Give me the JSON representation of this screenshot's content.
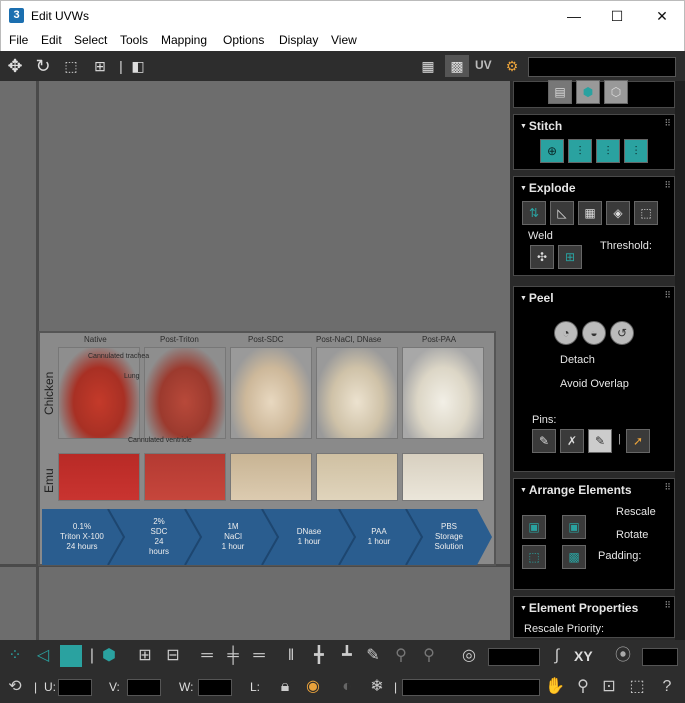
{
  "window": {
    "title": "Edit UVWs",
    "app_icon": "3",
    "minimize": "—",
    "maximize": "☐",
    "close": "✕"
  },
  "menu": [
    "File",
    "Edit",
    "Select",
    "Tools",
    "Mapping",
    "Options",
    "Display",
    "View"
  ],
  "toolbar": {
    "uv_label": "UV"
  },
  "image": {
    "columns": [
      "Native",
      "Post-Triton",
      "Post-SDC",
      "Post-NaCl, DNase",
      "Post-PAA"
    ],
    "rows": [
      "Chicken",
      "Emu"
    ],
    "annotations": [
      "Cannulated trachea",
      "Lung",
      "Cannulated ventricle"
    ],
    "steps": [
      [
        "0.1%",
        "Triton X-100",
        "24 hours"
      ],
      [
        "2%",
        "SDC",
        "24",
        "hours"
      ],
      [
        "1M",
        "NaCl",
        "1 hour"
      ],
      [
        "DNase",
        "1 hour"
      ],
      [
        "PAA",
        "1 hour"
      ],
      [
        "PBS",
        "Storage",
        "Solution"
      ]
    ]
  },
  "panel": {
    "stitch": {
      "title": "Stitch"
    },
    "explode": {
      "title": "Explode",
      "weld": "Weld",
      "threshold": "Threshold:"
    },
    "peel": {
      "title": "Peel",
      "detach": "Detach",
      "avoid_overlap": "Avoid Overlap",
      "pins": "Pins:"
    },
    "arrange": {
      "title": "Arrange Elements",
      "rescale": "Rescale",
      "rotate": "Rotate",
      "padding": "Padding:"
    },
    "element_props": {
      "title": "Element Properties",
      "rescale_priority": "Rescale Priority:"
    }
  },
  "bottom": {
    "xy": "XY",
    "u": "U:",
    "v": "V:",
    "w": "W:",
    "l": "L:"
  },
  "colors": {
    "teal": "#2aa2a0",
    "panel": "#000000",
    "toolbar": "#2d2d2d",
    "viewport": "#6d6d6d"
  }
}
